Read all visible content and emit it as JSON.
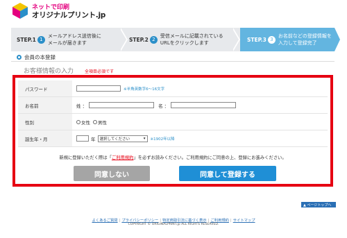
{
  "brand": {
    "tagline": "ネットで印刷",
    "name": "オリジナルプリント.jp"
  },
  "steps": [
    {
      "label": "STEP.1",
      "num": "1",
      "text": "メールアドレス送信後に\nメールが届きます"
    },
    {
      "label": "STEP.2",
      "num": "2",
      "text": "受信メールに記載されている\nURLをクリックします"
    },
    {
      "label": "STEP.3",
      "num": "3",
      "text": "お名前などの登録情報を\n入力して登録完了"
    }
  ],
  "section": {
    "title": "会員の本登録"
  },
  "form": {
    "heading": "お客様情報の入力",
    "required_note": "全項目必須です",
    "password": {
      "label": "パスワード",
      "hint": "※半角英数字6～16文字"
    },
    "name": {
      "label": "お名前",
      "last_prefix": "姓 ：",
      "first_prefix": "名 ："
    },
    "gender": {
      "label": "性別",
      "female": "女性",
      "male": "男性"
    },
    "birth": {
      "label": "誕生年・月",
      "year_suffix": "年",
      "month_select": "選択してください",
      "hint": "※1902年以降"
    },
    "agree": {
      "prefix": "新規に登録いただく際は「",
      "link": "ご利用規約",
      "suffix": "」を必ずお読みください。ご利用規約にご同意の上、登録にお進みください。"
    },
    "buttons": {
      "disagree": "同意しない",
      "agree": "同意して登録する"
    }
  },
  "pagetop": "▲ ページトップへ",
  "footer": {
    "links": [
      "よくあるご質問",
      "プライバシーポリシー",
      "特定商取引法に基づく表示",
      "ご利用規約",
      "サイトマップ"
    ],
    "copyright": "COPYRIGHT © ORIGINALPRINT.jp ALL RIGHTS RESERVED."
  },
  "colors": {
    "accent": "#2a8fc9",
    "highlight": "#e60012",
    "active_step": "#63b5e0",
    "brand_pink": "#e4007f"
  }
}
